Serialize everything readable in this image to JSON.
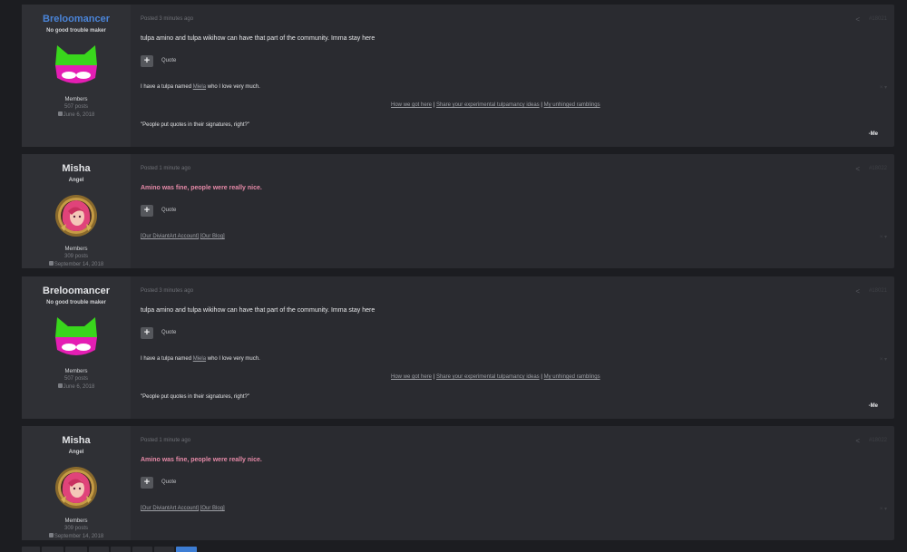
{
  "posts": [
    {
      "author": "Breloomancer",
      "title": "No good trouble maker",
      "group": "Members",
      "posts": "507 posts",
      "joined": "June 6, 2018",
      "posted": "Posted 3 minutes ago",
      "post_num": "#18021",
      "body": "tulpa amino and tulpa wikihow can have that part of the community. Imma stay here",
      "quote": "Quote",
      "sig_pre": "I have a tulpa named",
      "sig_link": "Miela",
      "sig_post": "who I love very much.",
      "sig_links": [
        "How we got here",
        "Share your experimental tulpamancy ideas",
        "My unhinged ramblings"
      ],
      "sig_quote": "\"People put quotes in their signatures, right?\"",
      "sig_end": "-Me"
    },
    {
      "author": "Misha",
      "title": "Angel",
      "group": "Members",
      "posts": "309 posts",
      "joined": "September 14, 2018",
      "posted": "Posted 1 minute ago",
      "post_num": "#18022",
      "body": "Amino was fine, people were really nice.",
      "quote": "Quote",
      "sig_a": "[Our DiviantArt Account]",
      "sig_b": "[Our Blog]"
    },
    {
      "author": "Breloomancer",
      "title": "No good trouble maker",
      "group": "Members",
      "posts": "507 posts",
      "joined": "June 6, 2018",
      "posted": "Posted 3 minutes ago",
      "post_num": "#18021",
      "body": "tulpa amino and tulpa wikihow can have that part of the community. Imma stay here",
      "quote": "Quote",
      "sig_pre": "I have a tulpa named",
      "sig_link": "Miela",
      "sig_post": "who I love very much.",
      "sig_links": [
        "How we got here",
        "Share your experimental tulpamancy ideas",
        "My unhinged ramblings"
      ],
      "sig_quote": "\"People put quotes in their signatures, right?\"",
      "sig_end": "-Me"
    },
    {
      "author": "Misha",
      "title": "Angel",
      "group": "Members",
      "posts": "309 posts",
      "joined": "September 14, 2018",
      "posted": "Posted 1 minute ago",
      "post_num": "#18022",
      "body": "Amino was fine, people were really nice.",
      "quote": "Quote",
      "sig_a": "[Our DiviantArt Account]",
      "sig_b": "[Our Blog]"
    }
  ],
  "colors": {
    "accent": "#3d7dd3",
    "author_blue": "#4a84d8",
    "pink_text": "#e68aa8",
    "bg": "#1c1d21",
    "post_bg": "#2a2b30"
  },
  "icons": {
    "share": "share-icon",
    "calendar": "calendar-icon",
    "plus": "plus-icon",
    "avatar_1": "green-magenta-mask-avatar",
    "avatar_2": "pink-haired-girl-avatar"
  }
}
